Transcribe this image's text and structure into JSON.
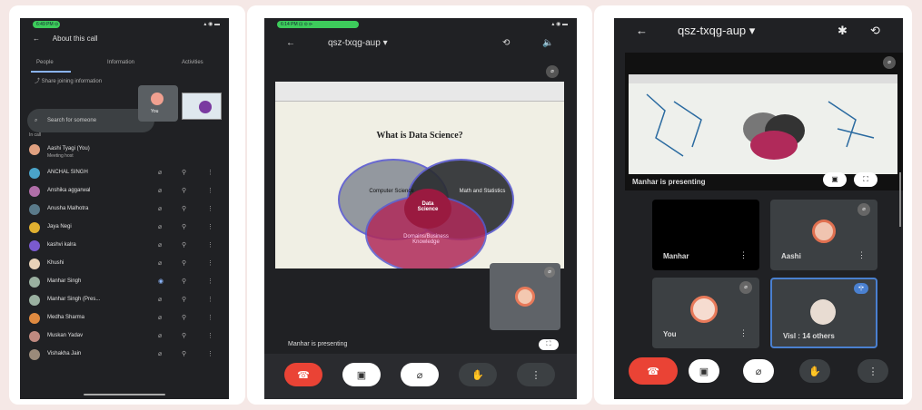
{
  "panel1": {
    "status_time": "6:49 PM ⊙",
    "header_title": "About this call",
    "tabs": [
      "People",
      "Information",
      "Activities"
    ],
    "share_text": "Share joining information",
    "search_placeholder": "Search for someone",
    "pip_label": "You",
    "section_label": "In call",
    "host": {
      "name": "Aashi Tyagi (You)",
      "role": "Meeting host"
    },
    "people": [
      {
        "name": "ANCHAL SINGH",
        "color": "#4aa3c8"
      },
      {
        "name": "Anshika aggarwal",
        "color": "#b06ea8"
      },
      {
        "name": "Anusha Malhotra",
        "color": "#5a7a8a"
      },
      {
        "name": "Jaya Negi",
        "color": "#e0b030"
      },
      {
        "name": "kashvi kalra",
        "color": "#7a5ad0"
      },
      {
        "name": "Khushi",
        "color": "#e8d2b8"
      },
      {
        "name": "Manhar Singh",
        "color": "#9ab0a0"
      },
      {
        "name": "Manhar Singh (Pres...",
        "color": "#9ab0a0"
      },
      {
        "name": "Medha Sharma",
        "color": "#e08a40"
      },
      {
        "name": "Muskan Yadav",
        "color": "#c08a80"
      },
      {
        "name": "Vishakha Jain",
        "color": "#9a8a7a"
      }
    ]
  },
  "panel2": {
    "status_time": "6:14 PM ⊡ ⊙ ⊳",
    "meeting_code": "qsz-txqg-aup ▾",
    "slide_title": "What is Data Science?",
    "venn": [
      "Computer Science",
      "Math and Statistics",
      "Data Science",
      "Domains/Business Knowledge"
    ],
    "presenting": "Manhar is presenting"
  },
  "panel3": {
    "meeting_code": "qsz-txqg-aup ▾",
    "presenting": "Manhar is presenting",
    "tiles": [
      {
        "label": "Manhar"
      },
      {
        "label": "Aashi"
      },
      {
        "label": "You"
      },
      {
        "label": "Visl : 14 others"
      }
    ]
  }
}
